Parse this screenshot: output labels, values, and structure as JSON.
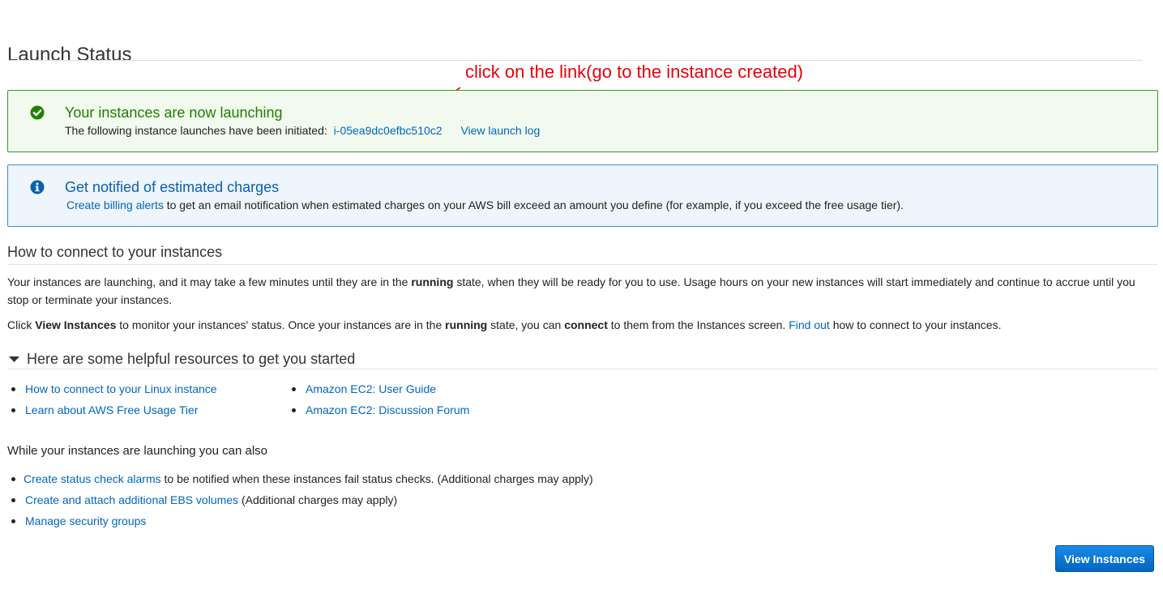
{
  "page": {
    "title": "Launch Status"
  },
  "annotation": {
    "text": "click on the link(go to the instance created)",
    "color": "#e8000b"
  },
  "success_alert": {
    "heading": "Your instances are now launching",
    "text": "The following instance launches have been initiated:",
    "instance_link": "i-05ea9dc0efbc510c2",
    "log_link": "View launch log",
    "icon": "check-circle-icon",
    "color": "#1d8102"
  },
  "info_alert": {
    "heading": "Get notified of estimated charges",
    "link": "Create billing alerts",
    "text": "to get an email notification when estimated charges on your AWS bill exceed an amount you define (for example, if you exceed the free usage tier).",
    "icon": "info-circle-icon",
    "color": "#0a60b0"
  },
  "connect": {
    "heading": "How to connect to your instances",
    "para1": {
      "before": "Your instances are launching, and it may take a few minutes until they are in the ",
      "bold": "running",
      "after": " state, when they will be ready for you to use. Usage hours on your new instances will start immediately and continue to accrue until you stop or terminate your instances."
    },
    "para2": {
      "t1": "Click ",
      "b1": "View Instances",
      "t2": " to monitor your instances' status. Once your instances are in the ",
      "b2": "running",
      "t3": " state, you can ",
      "b3": "connect",
      "t4": " to them from the Instances screen. ",
      "link": "Find out",
      "t5": " how to connect to your instances."
    }
  },
  "resources": {
    "heading": "Here are some helpful resources to get you started",
    "left": [
      "How to connect to your Linux instance",
      "Learn about AWS Free Usage Tier"
    ],
    "right": [
      "Amazon EC2: User Guide",
      "Amazon EC2: Discussion Forum"
    ]
  },
  "also": {
    "heading": "While your instances are launching you can also",
    "items": [
      {
        "link": "Create status check alarms",
        "text": "to be notified when these instances fail status checks. (Additional charges may apply)"
      },
      {
        "link": "Create and attach additional EBS volumes",
        "text": "(Additional charges may apply)"
      },
      {
        "link": "Manage security groups",
        "text": ""
      }
    ]
  },
  "footer": {
    "button": "View Instances"
  }
}
